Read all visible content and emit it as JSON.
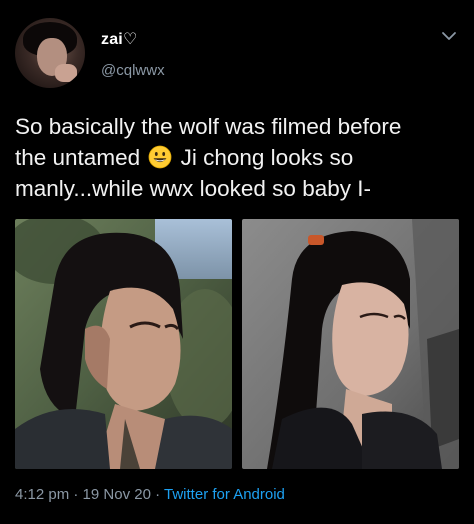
{
  "tweet": {
    "display_name": "zai♡",
    "username": "@cqlwwx",
    "text_lines": [
      "So basically the wolf was filmed before",
      "the untamed",
      "Ji chong looks so",
      "manly...while wwx looked so baby I-"
    ],
    "emoji": "grinning-face-emoji",
    "time": "4:12 pm",
    "separator": "·",
    "date": "19 Nov 20",
    "source": "Twitter for Android"
  },
  "colors": {
    "background": "#000000",
    "text": "#ffffff",
    "muted": "#8b98a5",
    "link": "#1da1f2"
  },
  "icons": {
    "more": "chevron-down-icon"
  }
}
